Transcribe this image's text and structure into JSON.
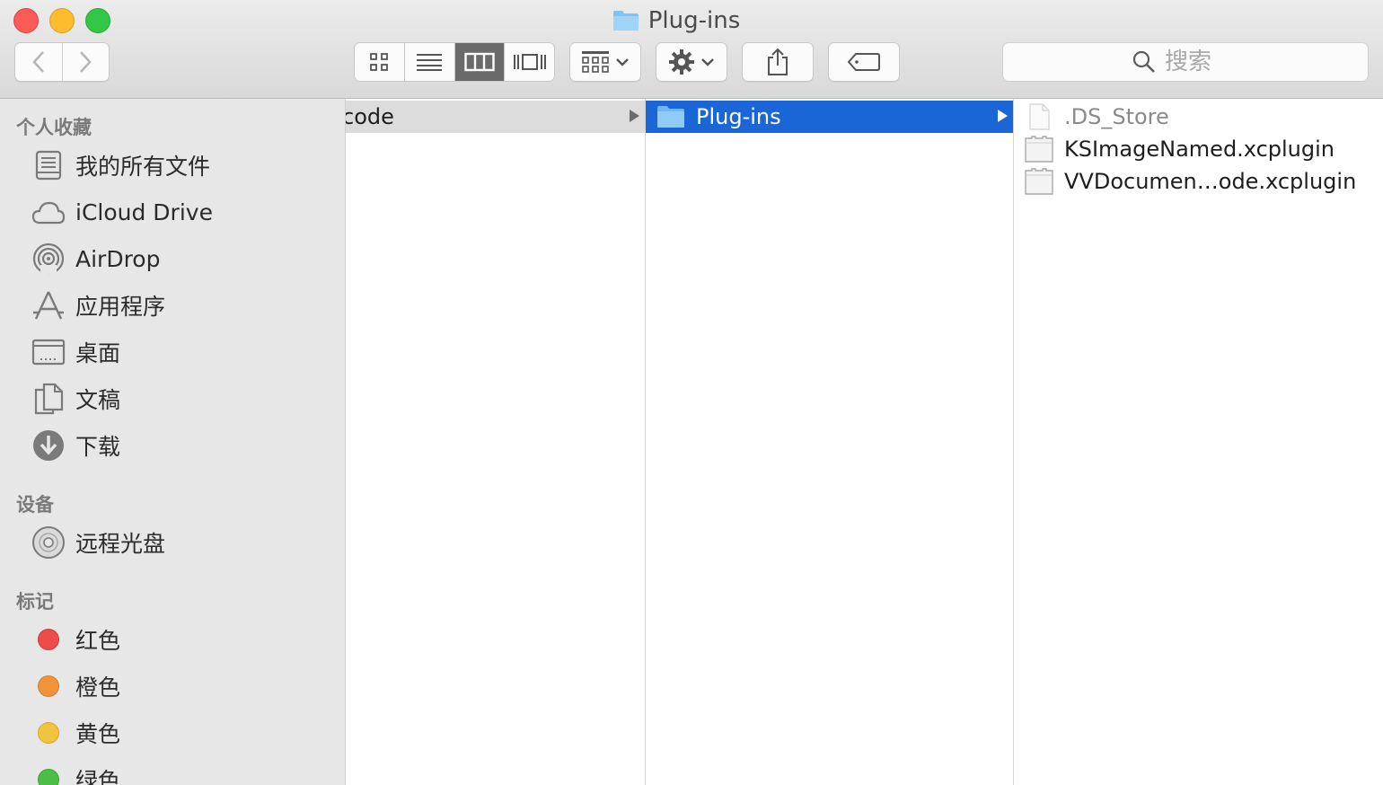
{
  "window": {
    "title": "Plug-ins"
  },
  "toolbar": {
    "search_placeholder": "搜索"
  },
  "colors": {
    "selection": "#1a66d6",
    "tag_red": "#ee4b4b",
    "tag_orange": "#f0943c",
    "tag_yellow": "#f2c43d",
    "tag_green": "#4bbf45"
  },
  "sidebar": {
    "favorites_title": "个人收藏",
    "favorites": [
      {
        "label": "我的所有文件",
        "icon": "all-files-icon"
      },
      {
        "label": "iCloud Drive",
        "icon": "cloud-icon"
      },
      {
        "label": "AirDrop",
        "icon": "airdrop-icon"
      },
      {
        "label": "应用程序",
        "icon": "applications-icon"
      },
      {
        "label": "桌面",
        "icon": "desktop-icon"
      },
      {
        "label": "文稿",
        "icon": "documents-icon"
      },
      {
        "label": "下载",
        "icon": "download-icon"
      }
    ],
    "devices_title": "设备",
    "devices": [
      {
        "label": "远程光盘",
        "icon": "disc-icon"
      }
    ],
    "tags_title": "标记",
    "tags": [
      {
        "label": "红色",
        "color": "#ee4b4b"
      },
      {
        "label": "橙色",
        "color": "#f0943c"
      },
      {
        "label": "黄色",
        "color": "#f2c43d"
      },
      {
        "label": "绿色",
        "color": "#4bbf45"
      }
    ]
  },
  "columns": {
    "col1": {
      "items": [
        {
          "name": "code"
        }
      ]
    },
    "col2": {
      "items": [
        {
          "name": "Plug-ins"
        }
      ]
    },
    "col3": {
      "items": [
        {
          "name": ".DS_Store"
        },
        {
          "name": "KSImageNamed.xcplugin"
        },
        {
          "name": "VVDocumen…ode.xcplugin"
        }
      ]
    }
  }
}
